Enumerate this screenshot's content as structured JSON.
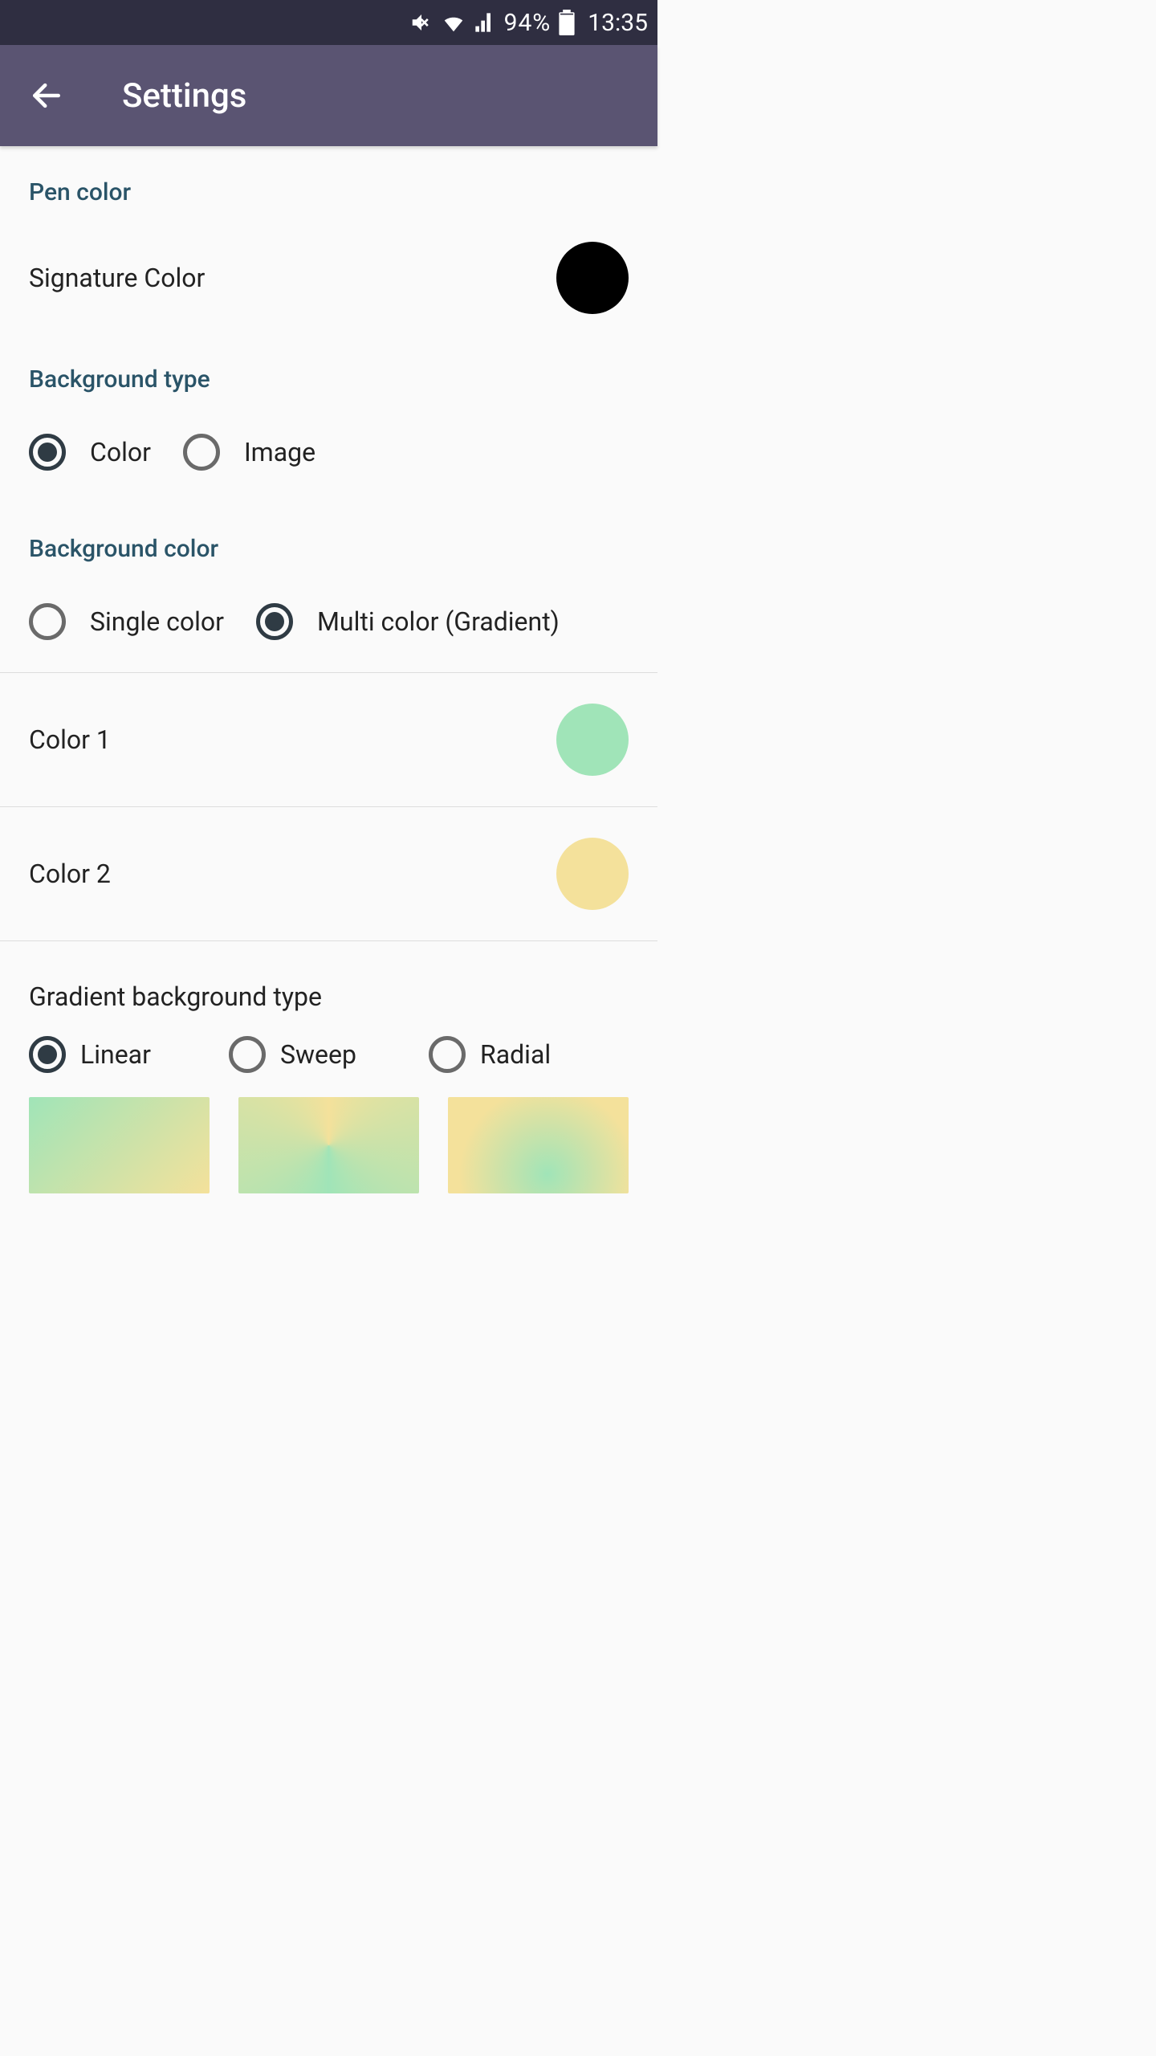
{
  "status_bar": {
    "battery": "94%",
    "time": "13:35"
  },
  "app_bar": {
    "title": "Settings"
  },
  "sections": {
    "pen_color": {
      "header": "Pen color",
      "signature_label": "Signature Color",
      "signature_color": "#000000"
    },
    "background_type": {
      "header": "Background type",
      "options": {
        "color": "Color",
        "image": "Image"
      },
      "selected": "color"
    },
    "background_color": {
      "header": "Background color",
      "options": {
        "single": "Single color",
        "multi": "Multi color (Gradient)"
      },
      "selected": "multi",
      "color1_label": "Color 1",
      "color1": "#a0e4b8",
      "color2_label": "Color 2",
      "color2": "#f4e19b"
    },
    "gradient_type": {
      "header": "Gradient background type",
      "options": {
        "linear": "Linear",
        "sweep": "Sweep",
        "radial": "Radial"
      },
      "selected": "linear"
    }
  }
}
